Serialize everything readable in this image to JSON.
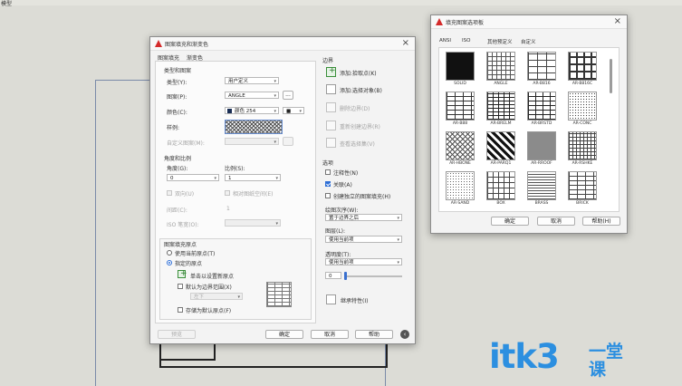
{
  "top_strip_text": "模型",
  "hatch_dialog": {
    "title": "图案填充和渐变色",
    "tabs": [
      "图案填充",
      "渐变色"
    ],
    "type_and_pattern": {
      "group_label": "类型和图案",
      "type_label": "类型(Y):",
      "type_value": "用户定义",
      "pattern_label": "图案(P):",
      "pattern_value": "ANGLE",
      "pattern_more": "...",
      "color_label": "颜色(C):",
      "color_value": "颜色 254",
      "color_bg_value": "■",
      "sample_label": "样例:",
      "custom_pattern_label": "自定义图案(M):"
    },
    "angle_scale": {
      "group_label": "角度和比例",
      "angle_label": "角度(G):",
      "angle_value": "0",
      "scale_label": "比例(S):",
      "scale_value": "1",
      "double_label": "双向(U)",
      "relative_label": "相对图纸空间(E)",
      "spacing_label": "间距(C):",
      "spacing_value": "1",
      "iso_label": "ISO 笔宽(O):"
    },
    "origin": {
      "group_label": "图案填充原点",
      "use_current_label": "使用当前原点(T)",
      "specified_label": "指定的原点",
      "click_set_label": "单击以设置新原点",
      "default_extent_label": "默认为边界范围(X)",
      "position_value": "左下",
      "store_default_label": "存储为默认原点(F)"
    },
    "boundary": {
      "group_label": "边界",
      "add_pick_label": "添加:拾取点(K)",
      "add_select_label": "添加:选择对象(B)",
      "remove_label": "删除边界(D)",
      "recreate_label": "重新创建边界(R)",
      "view_label": "查看选择集(V)"
    },
    "options": {
      "group_label": "选项",
      "annotative_label": "注释性(N)",
      "associative_label": "关联(A)",
      "separate_label": "创建独立的图案填充(H)",
      "draw_order_label": "绘图次序(W):",
      "draw_order_value": "置于边界之后",
      "layer_label": "图层(L):",
      "layer_value": "使用当前项",
      "transparency_label": "透明度(T):",
      "transparency_value": "使用当前项",
      "transparency_number": "0"
    },
    "inherit_label": "继承特性(I)",
    "buttons": {
      "preview": "预览",
      "ok": "确定",
      "cancel": "取消",
      "help": "帮助"
    }
  },
  "palette_dialog": {
    "title": "填充图案选项板",
    "tabs": [
      "ANSI",
      "ISO",
      "其他预定义",
      "自定义"
    ],
    "patterns": [
      "SOLID",
      "ANGLE",
      "AR-B816",
      "AR-B816C",
      "AR-B88",
      "AR-BRELM",
      "AR-BRSTD",
      "AR-CONC",
      "AR-HBONE",
      "AR-PARQ1",
      "AR-RROOF",
      "AR-RSHKE",
      "AR-SAND",
      "BOX",
      "BRASS",
      "BRICK"
    ],
    "buttons": {
      "ok": "确定",
      "cancel": "取消",
      "help": "帮助(H)"
    }
  },
  "watermark": {
    "brand": "itk3",
    "tag_line1": "一堂",
    "tag_line2": "课"
  },
  "colors": {
    "accent": "#2f6fd6",
    "autocad_red": "#d42a2a",
    "watermark": "#2c8fe0"
  }
}
